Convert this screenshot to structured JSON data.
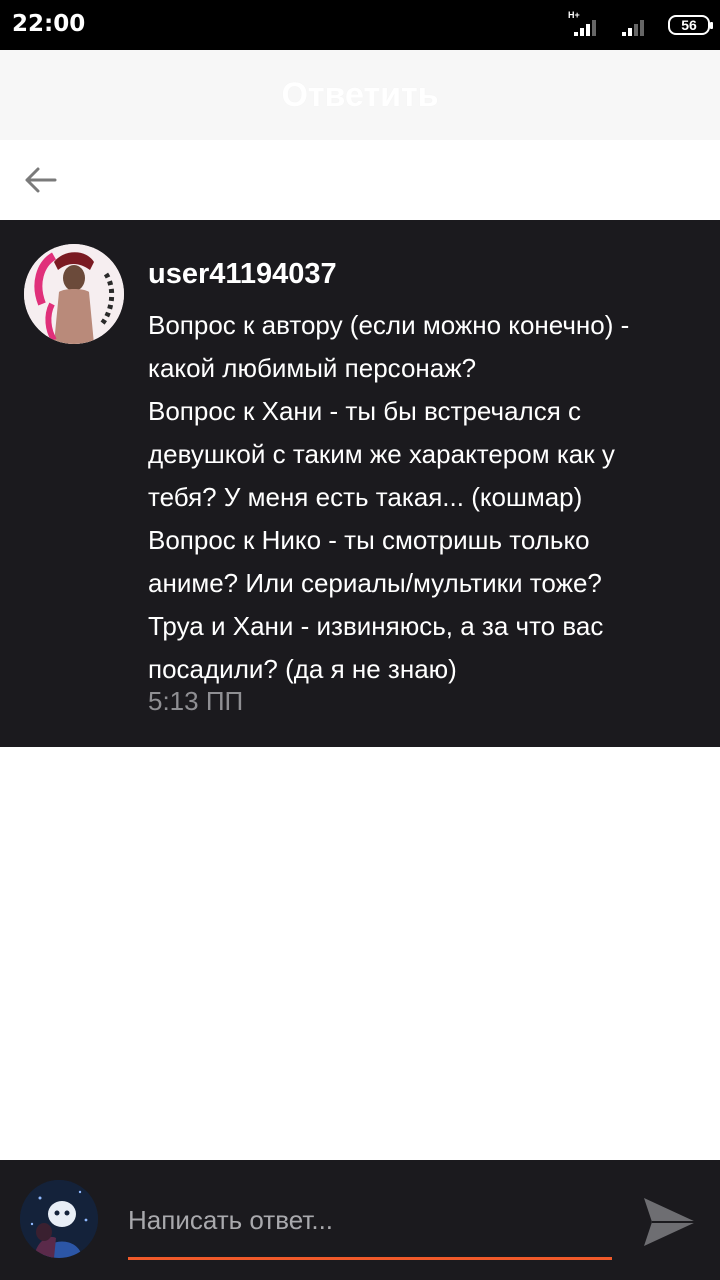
{
  "status_bar": {
    "time": "22:00",
    "network": "H+",
    "battery": "56"
  },
  "header": {
    "title": "Ответить"
  },
  "message": {
    "username": "user41194037",
    "lines": [
      "Вопрос к автору (если можно конечно) -",
      "какой любимый персонаж?",
      "Вопрос к Хани - ты бы встречался с",
      "девушкой с таким же характером как у",
      "тебя? У меня есть такая... (кошмар)",
      "Вопрос к Нико - ты смотришь только",
      "аниме? Или сериалы/мультики тоже?",
      "Труа и Хани - извиняюсь, а за что вас",
      "посадили? (да я не знаю)"
    ],
    "time": "5:13 ПП"
  },
  "composer": {
    "placeholder": "Написать ответ..."
  },
  "colors": {
    "accent": "#f05a2a",
    "card_bg": "#1b1a1e",
    "timestamp": "#8f8f93"
  },
  "icons": {
    "back": "arrow-left-icon",
    "send": "send-icon"
  }
}
